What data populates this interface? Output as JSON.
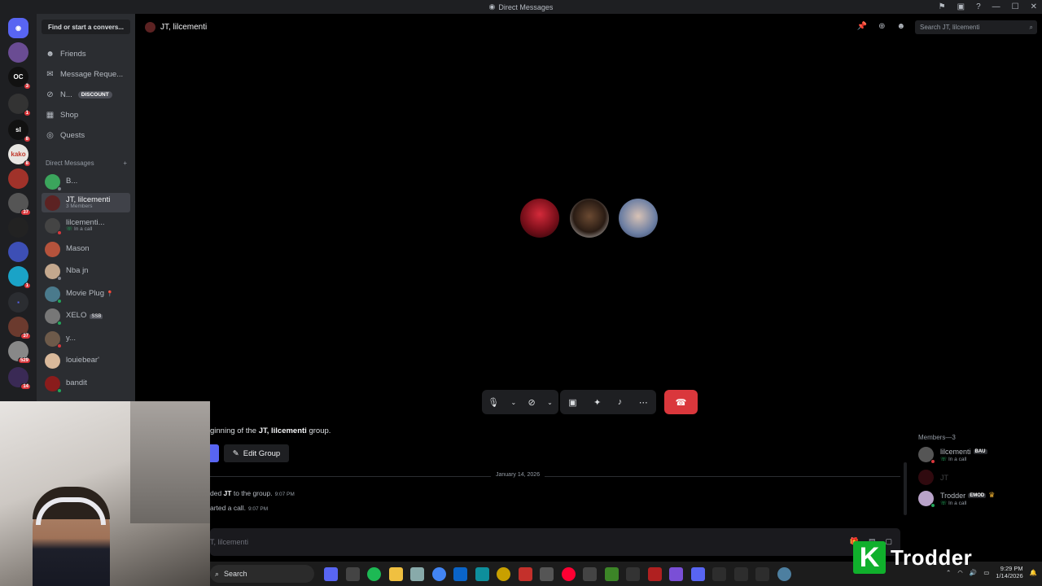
{
  "window": {
    "title": "Direct Messages"
  },
  "sidebar": {
    "find_placeholder": "Find or start a convers...",
    "nav": [
      {
        "label": "Friends",
        "icon": "friends-icon"
      },
      {
        "label": "Message Reque...",
        "icon": "mail-icon"
      },
      {
        "label": "N...",
        "icon": "nitro-icon",
        "badge": "DISCOUNT"
      },
      {
        "label": "Shop",
        "icon": "shop-icon"
      },
      {
        "label": "Quests",
        "icon": "quests-icon"
      }
    ],
    "dm_header": "Direct Messages",
    "dms": [
      {
        "name": "B...",
        "sub": ""
      },
      {
        "name": "JT, lilcementi",
        "sub": "3 Members"
      },
      {
        "name": "lilcementi...",
        "sub": "In a call"
      },
      {
        "name": "Mason",
        "sub": ""
      },
      {
        "name": "Nba jn",
        "sub": ""
      },
      {
        "name": "Movie Plug",
        "sub": ""
      },
      {
        "name": "XELO",
        "sub": "",
        "tag": "SSB"
      },
      {
        "name": "y...",
        "sub": ""
      },
      {
        "name": "louiebear'",
        "sub": ""
      },
      {
        "name": "bandit",
        "sub": ""
      }
    ]
  },
  "rail": {
    "badges": [
      "3",
      "1",
      "8",
      "8",
      "37",
      "1",
      "37",
      "529",
      "14"
    ]
  },
  "header": {
    "channel": "JT, lilcementi",
    "search_placeholder": "Search JT, lilcementi"
  },
  "chat": {
    "intro_prefix": "ginning of the ",
    "intro_group": "JT, lilcementi",
    "intro_suffix": " group.",
    "edit_group": "Edit Group",
    "date": "January 14, 2026",
    "msg1_prefix": "ded ",
    "msg1_user": "JT",
    "msg1_suffix": " to the group.",
    "msg1_time": "9:07 PM",
    "msg2_text": "arted a call.",
    "msg2_time": "9:07 PM",
    "input_placeholder": "T, lilcementi"
  },
  "members": {
    "header": "Members—3",
    "list": [
      {
        "name": "lilcementi",
        "tag": "BAU",
        "sub": "In a call"
      },
      {
        "name": "JT",
        "tag": "",
        "sub": ""
      },
      {
        "name": "Trodder",
        "tag": "EMOD",
        "sub": "In a call"
      }
    ]
  },
  "taskbar": {
    "search": "Search",
    "time": "9:29 PM",
    "date": "1/14/2026"
  },
  "watermark": {
    "text": "Trodder"
  },
  "colors": {
    "accent": "#5865f2",
    "danger": "#da373c",
    "online": "#23a55a"
  }
}
